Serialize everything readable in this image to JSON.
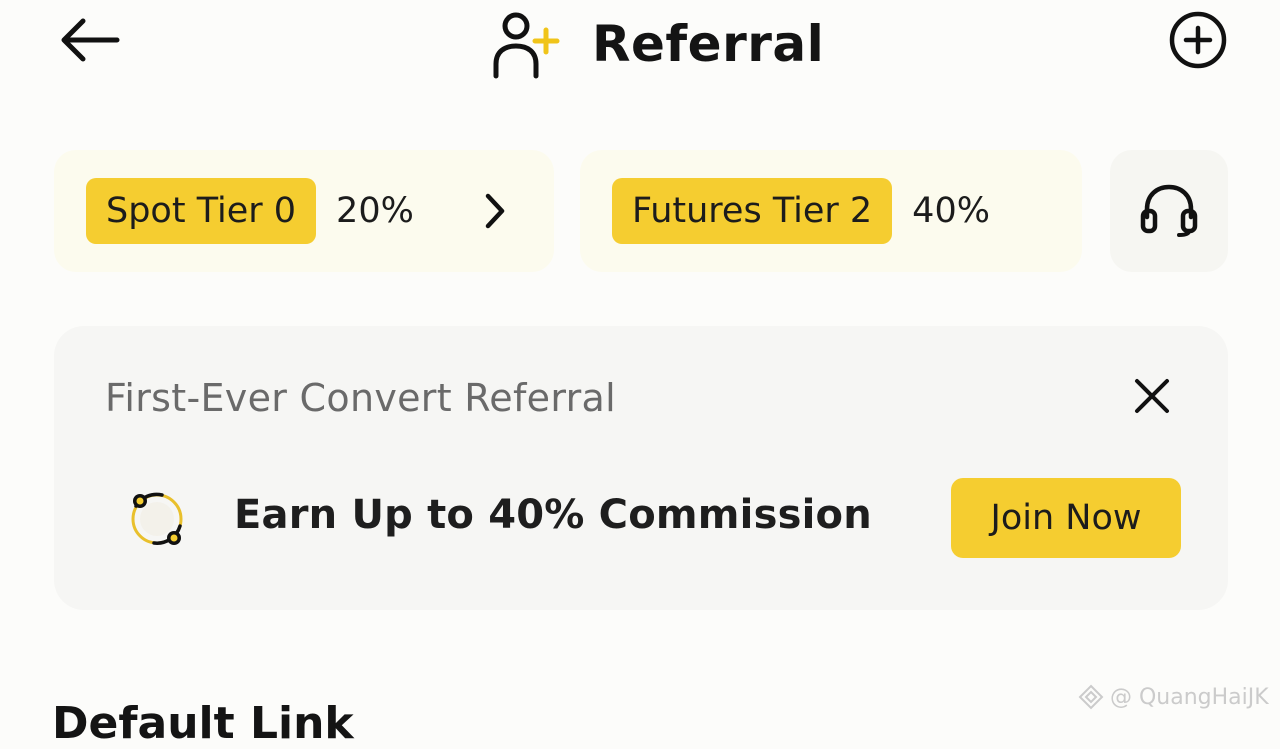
{
  "header": {
    "title": "Referral",
    "back_icon": "arrow-left-icon",
    "title_icon": "person-add-icon",
    "action_icon": "plus-circle-icon"
  },
  "tiers": [
    {
      "label": "Spot Tier 0",
      "rate": "20%",
      "has_chevron": true
    },
    {
      "label": "Futures Tier 2",
      "rate": "40%",
      "has_chevron": false
    }
  ],
  "support": {
    "icon": "headset-icon"
  },
  "promo": {
    "title": "First-Ever Convert Referral",
    "text": "Earn Up to 40% Commission",
    "button_label": "Join Now",
    "close_icon": "close-icon",
    "icon": "convert-coin-icon"
  },
  "section": {
    "title": "Default Link"
  },
  "watermark": {
    "text": "@ QuangHaiJK"
  },
  "colors": {
    "accent": "#f5cd30",
    "background": "#fcfcfa",
    "card": "#f6f6f4",
    "tier_card": "#fcfbee"
  }
}
